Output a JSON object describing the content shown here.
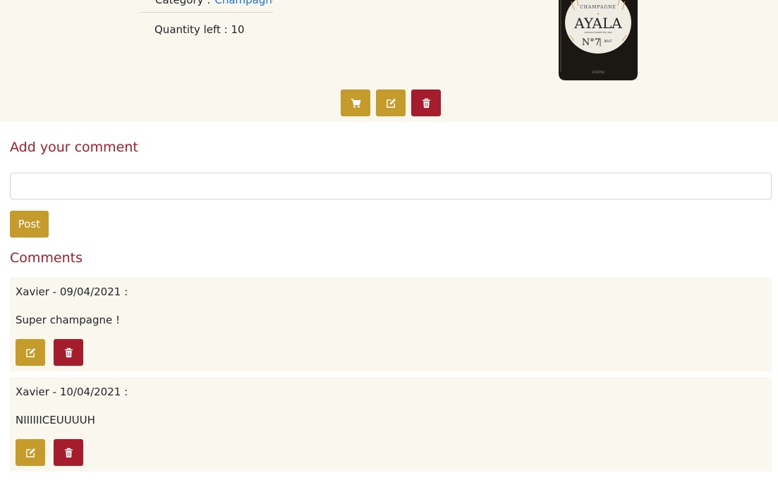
{
  "product": {
    "category_label": "Category :",
    "category_link": "Champagne",
    "quantity_label": "Quantity left : 10",
    "bottle": {
      "top_text": "CHAMPAGNE",
      "brand": "AYALA",
      "tagline": "MAISON FONDÉE EN 1860",
      "number": "N°7",
      "variant": "BRUT",
      "watermark": "vivino"
    },
    "actions": [
      {
        "name": "add-to-cart-button",
        "icon": "cart-icon",
        "color": "#c59c2c"
      },
      {
        "name": "edit-product-button",
        "icon": "edit-icon",
        "color": "#c59c2c"
      },
      {
        "name": "delete-product-button",
        "icon": "trash-icon",
        "color": "#a51c2d"
      }
    ]
  },
  "comment_form": {
    "heading": "Add your comment",
    "input_value": "",
    "input_placeholder": "",
    "post_label": "Post"
  },
  "comments_section": {
    "heading": "Comments",
    "items": [
      {
        "meta": "Xavier - 09/04/2021 :",
        "text": "Super champagne !"
      },
      {
        "meta": "Xavier - 10/04/2021 :",
        "text": "NIIIIIICEUUUUH"
      }
    ]
  },
  "colors": {
    "accent_gold": "#c59c2c",
    "accent_red": "#a51c2d",
    "panel_bg": "#faf7ef",
    "link_blue": "#1a73e8"
  }
}
